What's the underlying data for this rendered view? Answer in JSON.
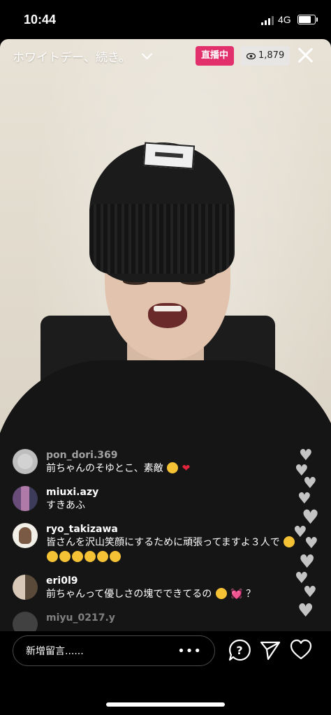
{
  "status_bar": {
    "time": "10:44",
    "network": "4G"
  },
  "live": {
    "title": "ホワイトデー、続き。",
    "badge": "直播中",
    "viewer_count": "1,879"
  },
  "comments": [
    {
      "username": "pon_dori.369",
      "text": "前ちゃんのそゆとこ、素敵"
    },
    {
      "username": "miuxi.azy",
      "text": "すきあふ"
    },
    {
      "username": "ryo_takizawa",
      "text": "皆さんを沢山笑顔にするために頑張ってますよ３人で"
    },
    {
      "username": "eri0l9",
      "text": "前ちゃんって優しさの塊でできてるの"
    },
    {
      "username": "miyu_0217.y",
      "text": ""
    }
  ],
  "comment_suffixes": {
    "c2_end": "？"
  },
  "input": {
    "placeholder": "新增留言......",
    "more": "•••"
  },
  "icons": [
    "eye-icon",
    "close-icon",
    "chevron-down-icon",
    "question-icon",
    "send-icon",
    "heart-icon"
  ]
}
